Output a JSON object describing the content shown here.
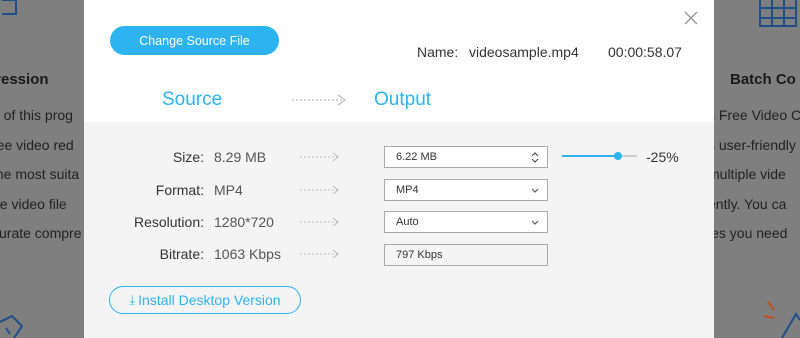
{
  "background": {
    "left_heading": "pression",
    "left_lines": [
      "d of this prog",
      "ree video red",
      "the most suita",
      "he video file",
      "curate compre"
    ],
    "right_heading": "Batch Co",
    "right_lines": [
      "s Free Video C",
      "s user-friendly",
      "multiple vide",
      "ently. You ca",
      "les you need"
    ]
  },
  "dialog": {
    "change_source_label": "Change Source File",
    "name_label": "Name:",
    "file_name": "videosample.mp4",
    "duration": "00:00:58.07",
    "source_header": "Source",
    "output_header": "Output",
    "rows": [
      {
        "label": "Size:",
        "source": "8.29 MB",
        "output": "6.22  MB",
        "control": "stepper"
      },
      {
        "label": "Format:",
        "source": "MP4",
        "output": "MP4",
        "control": "select"
      },
      {
        "label": "Resolution:",
        "source": "1280*720",
        "output": "Auto",
        "control": "select"
      },
      {
        "label": "Bitrate:",
        "source": "1063 Kbps",
        "output": "797 Kbps",
        "control": "readonly"
      }
    ],
    "compression_percent": "-25%",
    "slider_level": 0.75,
    "install_label": "Install Desktop Version"
  },
  "colors": {
    "accent": "#2db3f0",
    "overlay": "#7f7f7f"
  },
  "icons": [
    "close-icon",
    "arrow-right-icon",
    "stepper-icon",
    "chevron-down-icon",
    "download-icon"
  ]
}
